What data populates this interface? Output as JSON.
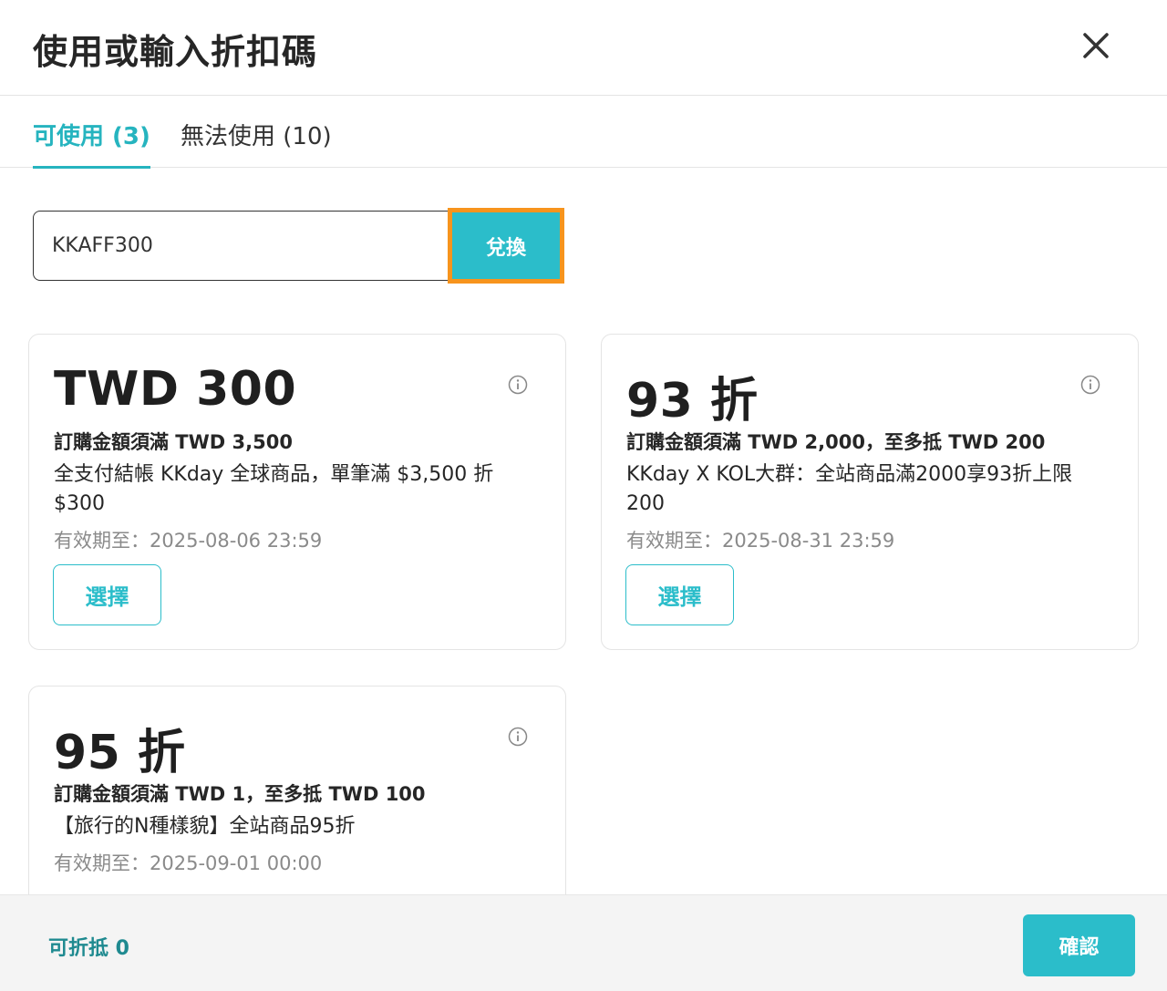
{
  "header": {
    "title": "使用或輸入折扣碼"
  },
  "tabs": [
    {
      "label": "可使用 (3)",
      "active": true
    },
    {
      "label": "無法使用 (10)",
      "active": false
    }
  ],
  "redeem": {
    "code_value": "KKAFF300",
    "button_label": "兌換"
  },
  "coupons": [
    {
      "amount": "TWD 300",
      "condition": "訂購金額須滿 TWD 3,500",
      "description": "全支付結帳 KKday 全球商品，單筆滿 $3,500 折 $300",
      "expiry": "有效期至：2025-08-06 23:59",
      "select_label": "選擇"
    },
    {
      "amount": "93 折",
      "condition": "訂購金額須滿 TWD 2,000，至多抵 TWD 200",
      "description": "KKday X KOL大群：全站商品滿2000享93折上限 200",
      "expiry": "有效期至：2025-08-31 23:59",
      "select_label": "選擇"
    },
    {
      "amount": "95 折",
      "condition": "訂購金額須滿 TWD 1，至多抵 TWD 100",
      "description": "【旅行的N種樣貌】全站商品95折",
      "expiry": "有效期至：2025-09-01 00:00"
    }
  ],
  "footer": {
    "deductible": "可折抵 0",
    "confirm_label": "確認"
  },
  "colors": {
    "accent": "#2bbdca",
    "highlight_border": "#f7941d",
    "footer_text": "#1f8a90"
  }
}
